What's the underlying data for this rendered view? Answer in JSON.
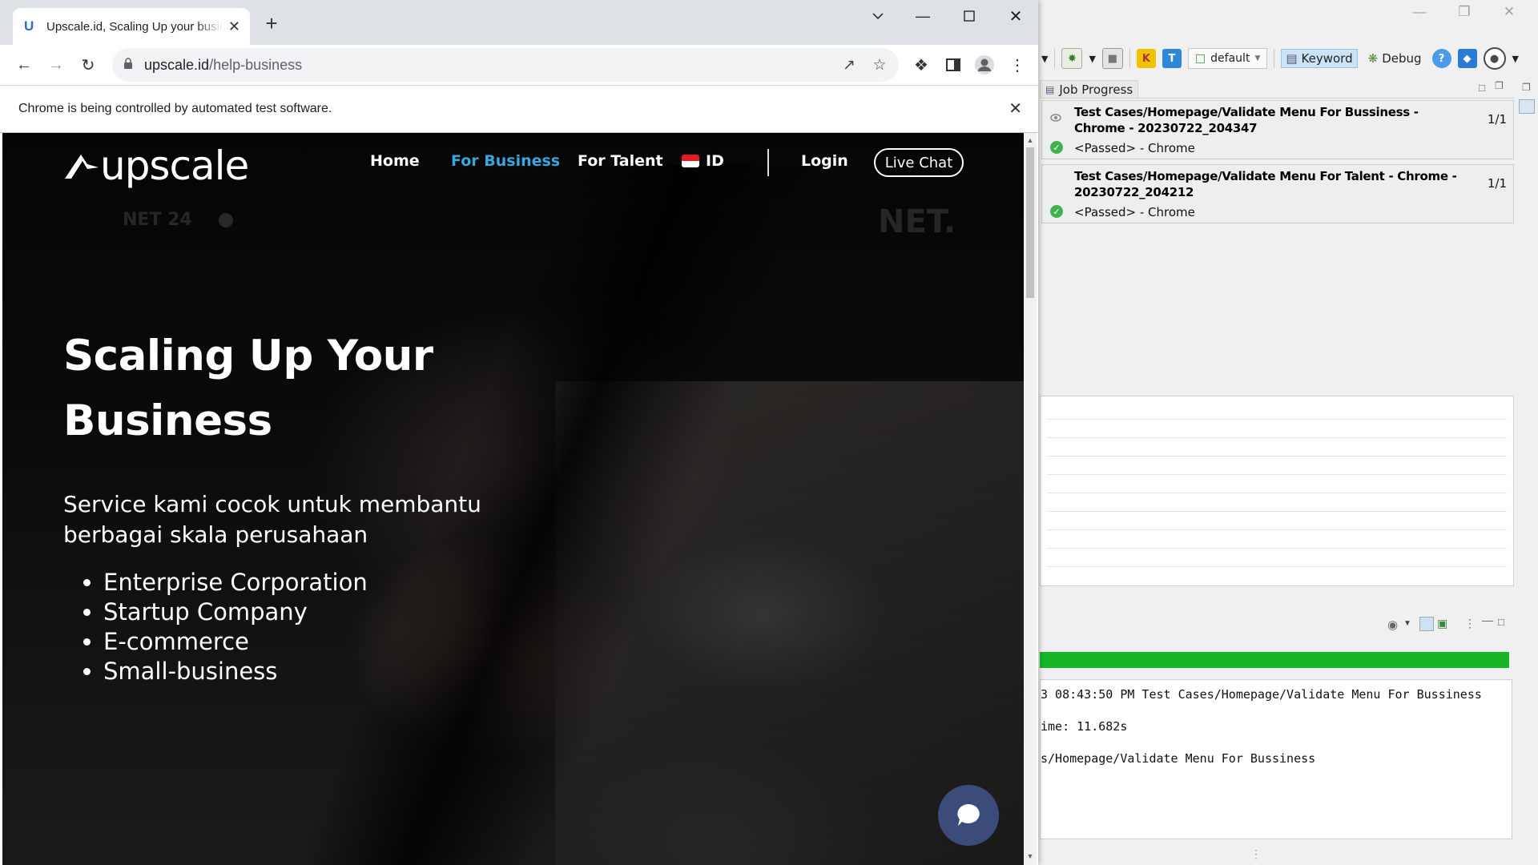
{
  "browser": {
    "tab_title": "Upscale.id, Scaling Up your business",
    "favicon_letter": "U",
    "url_domain": "upscale.id",
    "url_path": "/help-business",
    "infobar_text": "Chrome is being controlled by automated test software."
  },
  "site": {
    "logo_text": "upscale",
    "nav": {
      "home": "Home",
      "business": "For Business",
      "talent": "For Talent",
      "language": "ID",
      "login": "Login",
      "live_chat": "Live Chat"
    },
    "hero": {
      "title": "Scaling Up Your Business",
      "subtitle": "Service kami cocok untuk membantu berbagai skala perusahaan",
      "list": [
        "Enterprise Corporation",
        "Startup Company",
        "E-commerce",
        "Small-business"
      ]
    },
    "watermarks": {
      "left": "NET 24",
      "right": "NET."
    }
  },
  "ide": {
    "toolbar": {
      "profile_combo": "default",
      "keyword_label": "Keyword",
      "debug_label": "Debug"
    },
    "job_progress_tab": "Job Progress",
    "jobs": [
      {
        "title": "Test Cases/Homepage/Validate Menu For Bussiness - Chrome - 20230722_204347",
        "status": "<Passed> - Chrome",
        "count": "1/1"
      },
      {
        "title": "Test Cases/Homepage/Validate Menu For Talent - Chrome - 20230722_204212",
        "status": "<Passed> - Chrome",
        "count": "1/1"
      }
    ],
    "console": {
      "progress": 1.0,
      "lines": [
        "3 08:43:50 PM Test Cases/Homepage/Validate Menu For Bussiness",
        "ime: 11.682s",
        "s/Homepage/Validate Menu For Bussiness"
      ]
    }
  }
}
